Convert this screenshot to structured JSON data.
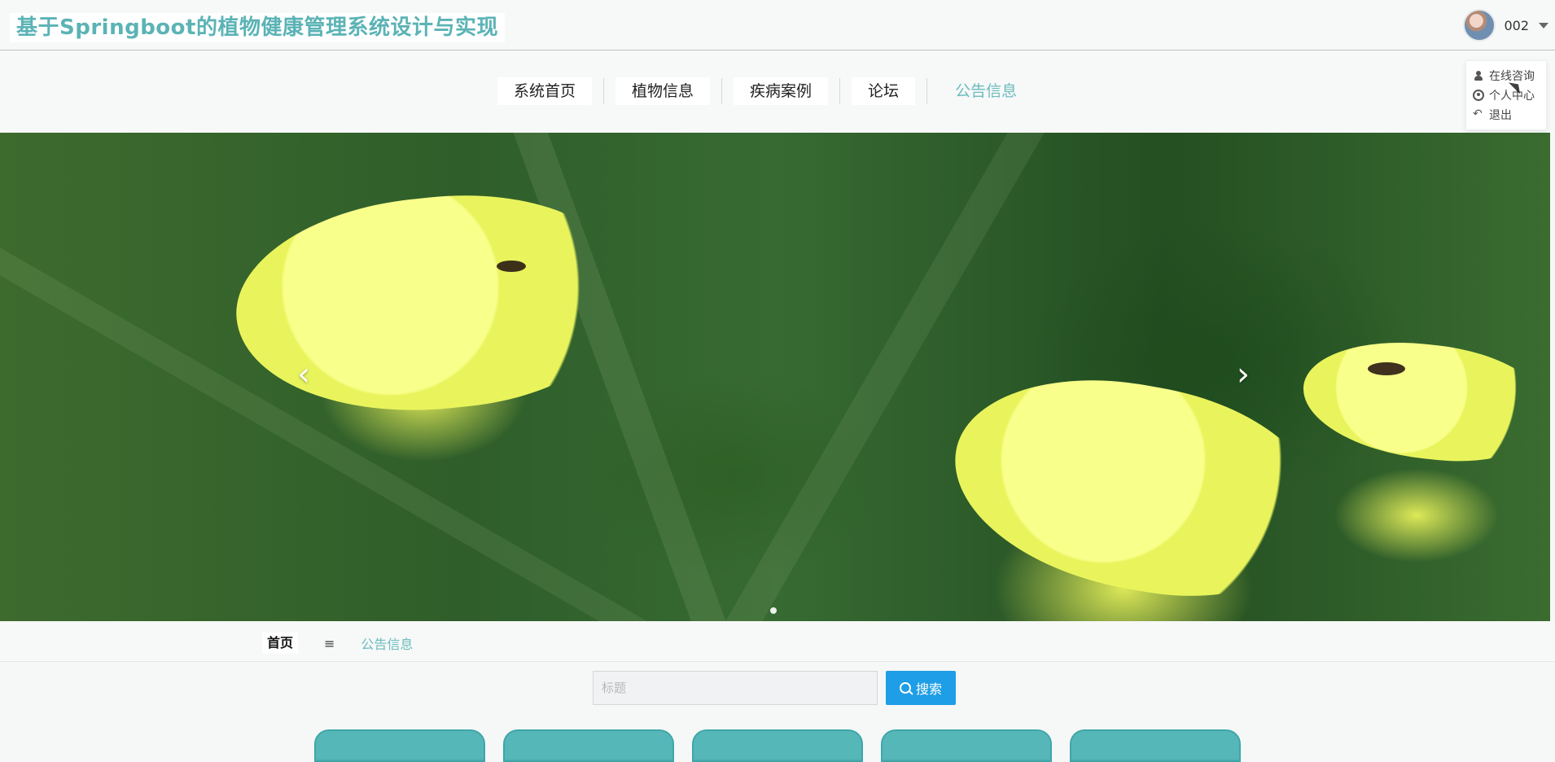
{
  "header": {
    "title": "基于Springboot的植物健康管理系统设计与实现",
    "user": {
      "name": "002",
      "menu": [
        {
          "label": "在线咨询",
          "icon": "person-icon"
        },
        {
          "label": "个人中心",
          "icon": "user-circle-icon"
        },
        {
          "label": "退出",
          "icon": "logout-icon"
        }
      ]
    }
  },
  "nav": {
    "items": [
      {
        "label": "系统首页",
        "active": false
      },
      {
        "label": "植物信息",
        "active": false
      },
      {
        "label": "疾病案例",
        "active": false
      },
      {
        "label": "论坛",
        "active": false
      },
      {
        "label": "公告信息",
        "active": true
      }
    ]
  },
  "banner": {
    "prev_icon": "chevron-left-icon",
    "next_icon": "chevron-right-icon"
  },
  "breadcrumb": {
    "home": "首页",
    "separator": "≡",
    "current": "公告信息"
  },
  "search": {
    "placeholder": "标题",
    "value": "",
    "button_label": "搜索"
  },
  "colors": {
    "brand_teal": "#5bb3b5",
    "active_teal": "#6bbcbe",
    "search_blue": "#1e9ee6",
    "card_teal": "#56b7b9"
  }
}
